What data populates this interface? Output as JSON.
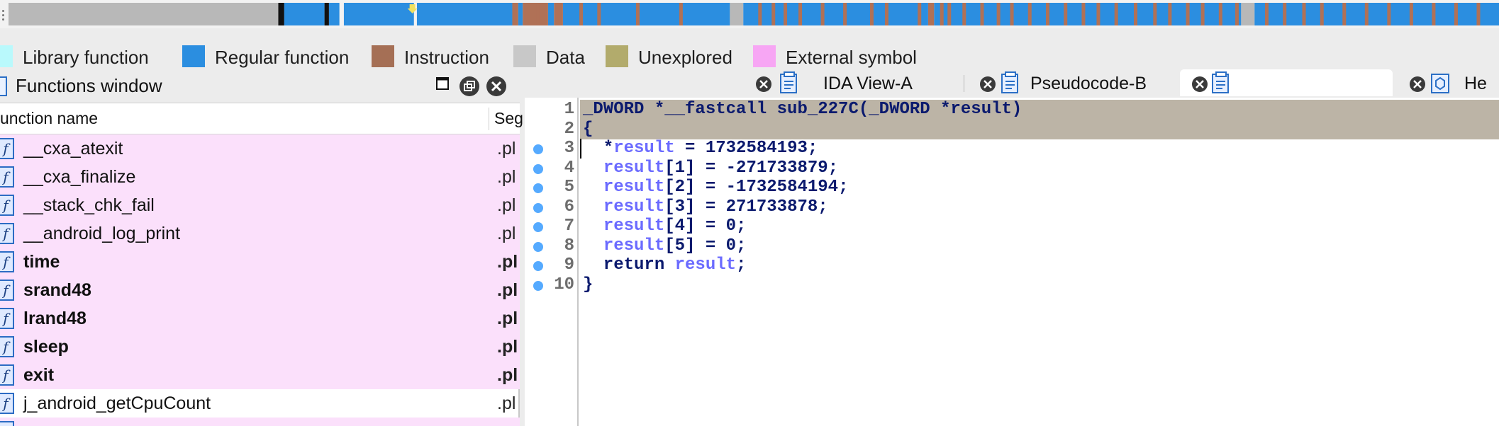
{
  "navigation_band": {
    "colors": {
      "data": "#b8b8b8",
      "regular": "#2b8ee0",
      "instruction": "#b07156",
      "boundary": "#111111",
      "marker": "#f0e060"
    },
    "segments": [
      [
        "data",
        0.0,
        0.181
      ],
      [
        "boundary",
        0.181,
        0.185
      ],
      [
        "regular",
        0.185,
        0.212
      ],
      [
        "boundary",
        0.212,
        0.215
      ],
      [
        "regular",
        0.215,
        0.222
      ],
      [
        "regular",
        0.225,
        0.272
      ],
      [
        "regular",
        0.274,
        0.338
      ],
      [
        "instruction",
        0.338,
        0.342
      ],
      [
        "regular",
        0.342,
        0.345
      ],
      [
        "instruction",
        0.345,
        0.362
      ],
      [
        "regular",
        0.362,
        0.366
      ],
      [
        "instruction",
        0.366,
        0.372
      ],
      [
        "regular",
        0.372,
        0.484
      ],
      [
        "data",
        0.484,
        0.493
      ],
      [
        "regular",
        0.493,
        0.617
      ],
      [
        "instruction",
        0.617,
        0.621
      ],
      [
        "regular",
        0.621,
        0.827
      ],
      [
        "data",
        0.827,
        0.836
      ],
      [
        "regular",
        0.836,
        1.0
      ]
    ],
    "instruction_flecks": [
      0.352,
      0.356,
      0.383,
      0.395,
      0.421,
      0.45,
      0.503,
      0.512,
      0.52,
      0.53,
      0.545,
      0.56,
      0.578,
      0.588,
      0.61,
      0.625,
      0.63,
      0.64,
      0.652,
      0.663,
      0.672,
      0.684,
      0.696,
      0.708,
      0.72,
      0.73,
      0.742,
      0.755,
      0.768,
      0.778,
      0.79,
      0.8,
      0.812,
      0.823,
      0.843,
      0.855,
      0.868,
      0.88,
      0.895,
      0.91,
      0.925,
      0.94,
      0.955,
      0.97,
      0.985
    ],
    "marker_pos": 0.271
  },
  "legend": [
    {
      "label": "Library function",
      "color": "#b9f9fc"
    },
    {
      "label": "Regular function",
      "color": "#2b8ee0"
    },
    {
      "label": "Instruction",
      "color": "#a56f55"
    },
    {
      "label": "Data",
      "color": "#c8c8c8"
    },
    {
      "label": "Unexplored",
      "color": "#b2ab6c"
    },
    {
      "label": "External symbol",
      "color": "#f7a6f4"
    }
  ],
  "functions_window": {
    "title": "Functions window",
    "col_name": "unction name",
    "col_segment": "Seg",
    "rows": [
      {
        "name": "__cxa_atexit",
        "segment": ".pl",
        "kind": "ext",
        "bold": false
      },
      {
        "name": "__cxa_finalize",
        "segment": ".pl",
        "kind": "ext",
        "bold": false
      },
      {
        "name": "__stack_chk_fail",
        "segment": ".pl",
        "kind": "ext",
        "bold": false
      },
      {
        "name": "__android_log_print",
        "segment": ".pl",
        "kind": "ext",
        "bold": false
      },
      {
        "name": "time",
        "segment": ".pl",
        "kind": "ext",
        "bold": true
      },
      {
        "name": "srand48",
        "segment": ".pl",
        "kind": "ext",
        "bold": true
      },
      {
        "name": "lrand48",
        "segment": ".pl",
        "kind": "ext",
        "bold": true
      },
      {
        "name": "sleep",
        "segment": ".pl",
        "kind": "ext",
        "bold": true
      },
      {
        "name": "exit",
        "segment": ".pl",
        "kind": "ext",
        "bold": true
      },
      {
        "name": "j_android_getCpuCount",
        "segment": ".pl",
        "kind": "plain",
        "bold": false
      }
    ]
  },
  "tabs": [
    {
      "label": "IDA View-A",
      "active": false
    },
    {
      "label": "Pseudocode-B",
      "active": false
    },
    {
      "label": "",
      "active": true
    },
    {
      "label": "He",
      "active": false
    }
  ],
  "code": {
    "lines": [
      {
        "n": "1",
        "dot": false,
        "hl": true,
        "parts": [
          [
            "kw",
            "_DWORD *__fastcall sub_227C(_DWORD *result)"
          ]
        ]
      },
      {
        "n": "2",
        "dot": false,
        "hl": true,
        "parts": [
          [
            "kw",
            "{"
          ]
        ]
      },
      {
        "n": "3",
        "dot": true,
        "hl": false,
        "parts": [
          [
            "kw",
            "  *"
          ],
          [
            "var",
            "result"
          ],
          [
            "kw",
            " = 1732584193;"
          ]
        ]
      },
      {
        "n": "4",
        "dot": true,
        "hl": false,
        "parts": [
          [
            "kw",
            "  "
          ],
          [
            "var",
            "result"
          ],
          [
            "kw",
            "[1] = -271733879;"
          ]
        ]
      },
      {
        "n": "5",
        "dot": true,
        "hl": false,
        "parts": [
          [
            "kw",
            "  "
          ],
          [
            "var",
            "result"
          ],
          [
            "kw",
            "[2] = -1732584194;"
          ]
        ]
      },
      {
        "n": "6",
        "dot": true,
        "hl": false,
        "parts": [
          [
            "kw",
            "  "
          ],
          [
            "var",
            "result"
          ],
          [
            "kw",
            "[3] = 271733878;"
          ]
        ]
      },
      {
        "n": "7",
        "dot": true,
        "hl": false,
        "parts": [
          [
            "kw",
            "  "
          ],
          [
            "var",
            "result"
          ],
          [
            "kw",
            "[4] = 0;"
          ]
        ]
      },
      {
        "n": "8",
        "dot": true,
        "hl": false,
        "parts": [
          [
            "kw",
            "  "
          ],
          [
            "var",
            "result"
          ],
          [
            "kw",
            "[5] = 0;"
          ]
        ]
      },
      {
        "n": "9",
        "dot": true,
        "hl": false,
        "parts": [
          [
            "kw",
            "  return "
          ],
          [
            "var",
            "result"
          ],
          [
            "kw",
            ";"
          ]
        ]
      },
      {
        "n": "10",
        "dot": true,
        "hl": false,
        "parts": [
          [
            "kw",
            "}"
          ]
        ]
      }
    ]
  },
  "icons": {
    "window_maximize": "maximize-icon",
    "window_restore": "restore-icon",
    "window_close": "close-icon",
    "function_item": "function-icon",
    "tab_close": "close-tab-icon",
    "tab_document": "document-icon",
    "tab_hex": "hex-view-icon"
  }
}
